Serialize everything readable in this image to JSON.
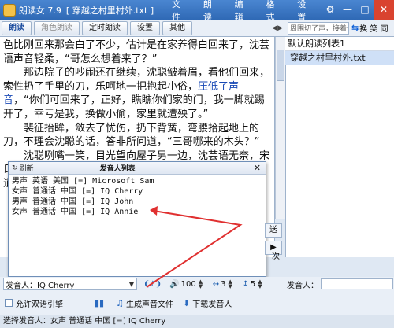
{
  "titlebar": {
    "app_name": "朗读女 7.9",
    "document": "[ 穿越之村里村外.txt ]",
    "menus": [
      "文件",
      "朗读",
      "编辑",
      "格式",
      "设置"
    ]
  },
  "toolbar": {
    "buttons": [
      "朗读",
      "角色朗读",
      "定时朗读",
      "设置",
      "其他"
    ]
  },
  "right_toolbar": {
    "hint": "周围切了声，接着说下，是要限段",
    "swap_label": "换 笑 同"
  },
  "text_content": {
    "paragraphs": [
      "色比刚回来那会白了不少，估计是在家养得白回来了，沈芸语声音轻柔，“哥怎么想着来了？”",
      "那边院子的吵闹还在继续，沈聪皱着眉，看他们回来，索性扔了手里的刀，乐呵地一把抱起小俗，",
      "压低了声音",
      "，“你们可回来了，正好，瞧瞧你们家的门，我一脚就踢开了，幸亏是我，换做小偷，家里就遭殃了。”",
      "裴征抬眸，敛去了忧伤，扔下背簧，弯腰拾起地上的刀，不理会沈聪的话，答非所问道，“三哥哪来的木头？”",
      "沈聪咧嘴一笑，目光望向屋子另一边，沈芸语无奈，宋氏报门，只怕也就沈聪能从宋氏手里抠出东西来，朝裴征道，“你把木头，宋氏来我会推还，文事你要的"
    ]
  },
  "playlist": {
    "header": "默认朗读列表1",
    "items": [
      "穿越之村里村外.txt"
    ]
  },
  "voice_dialog": {
    "refresh_label": "刷新",
    "title": "发音人列表",
    "voices": [
      "男声 英语 美国 [=] Microsoft Sam",
      "女声 普通话 中国 [=] IQ Cherry",
      "男声 普通话 中国 [=] IQ John",
      "女声 普通话 中国 [=] IQ Annie"
    ]
  },
  "side": {
    "go_label": "送",
    "next_label": "次"
  },
  "speaker_bar": {
    "selected": "发音人：IQ Cherry",
    "volume": "100",
    "speed": "3",
    "pitch": "5",
    "speaker_label": "发音人："
  },
  "actions": {
    "allow_lookup": "允许双语引擎",
    "generate": "生成声音文件",
    "download": "下载发音人"
  },
  "status": {
    "text": "选择发音人：女声 普通话 中国 [=] IQ Cherry"
  },
  "colors": {
    "title_bg": "#2f69b5",
    "highlight_text": "#1849b5",
    "arrow": "#e03030"
  }
}
